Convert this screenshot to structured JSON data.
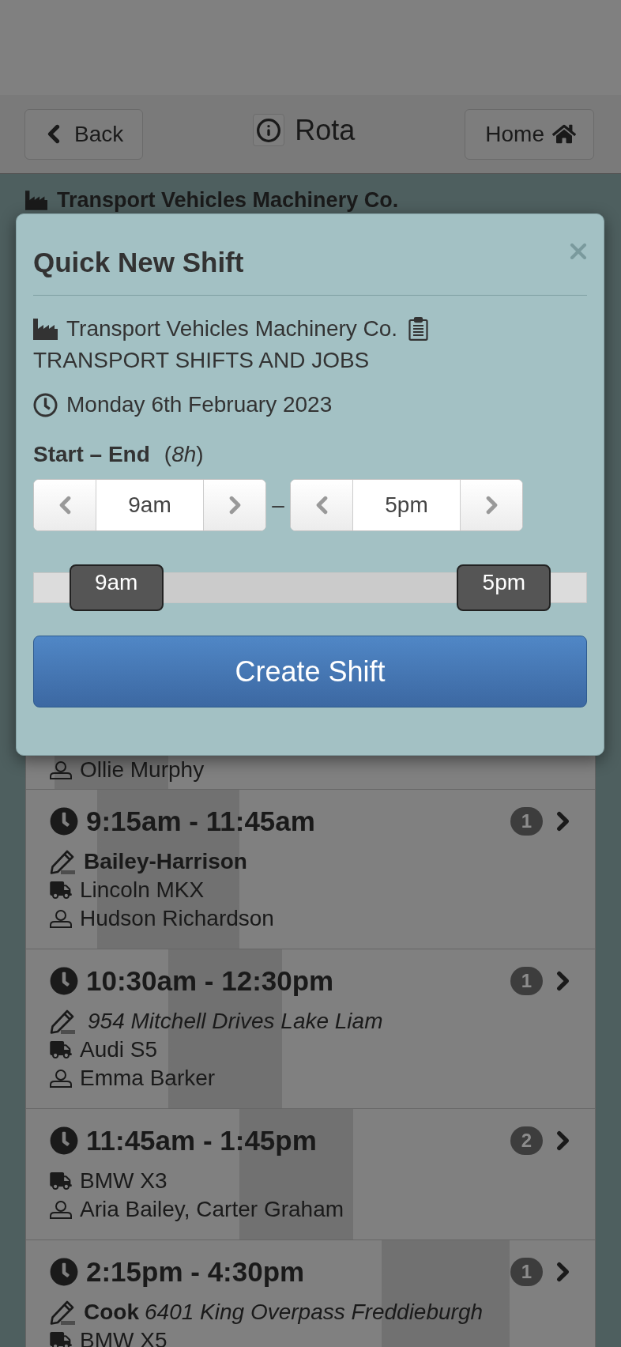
{
  "header": {
    "back": "Back",
    "title": "Rota",
    "home": "Home"
  },
  "company": "Transport Vehicles Machinery Co.",
  "modal": {
    "title": "Quick New Shift",
    "company": "Transport Vehicles Machinery Co.",
    "job": "TRANSPORT SHIFTS AND JOBS",
    "date": "Monday 6th February 2023",
    "range_label": "Start – End",
    "duration": "(*8h*)",
    "start": "9am",
    "separator": "–",
    "end": "5pm",
    "slider": {
      "thumbs": [
        {
          "label": "9am",
          "level": 0.15
        },
        {
          "label": "5pm",
          "level": 0.85
        }
      ]
    },
    "button": "Create Shift"
  },
  "shifts": [
    {
      "staff": "Ollie Murphy",
      "time_bar": [
        {
          "level": 0.05
        },
        {
          "level": 0.25
        }
      ]
    },
    {
      "time": "9:15am - 11:45am",
      "count": "1",
      "client": "Bailey-Harrison",
      "vehicle": "Lincoln MKX",
      "staff": "Hudson Richardson",
      "time_bar": [
        {
          "level": 0.125
        },
        {
          "level": 0.375
        }
      ]
    },
    {
      "time": "10:30am - 12:30pm",
      "count": "1",
      "address": "954 Mitchell Drives Lake Liam",
      "vehicle": "Audi S5",
      "staff": "Emma Barker",
      "time_bar": [
        {
          "level": 0.25
        },
        {
          "level": 0.45
        }
      ]
    },
    {
      "time": "11:45am - 1:45pm",
      "count": "2",
      "vehicle": "BMW X3",
      "staff": "Aria Bailey, Carter Graham",
      "time_bar": [
        {
          "level": 0.375
        },
        {
          "level": 0.575
        }
      ]
    },
    {
      "time": "2:15pm - 4:30pm",
      "count": "1",
      "client": "Cook",
      "address": "6401 King Overpass Freddieburgh",
      "vehicle": "BMW X5",
      "time_bar": [
        {
          "level": 0.625
        },
        {
          "level": 0.85
        }
      ]
    }
  ]
}
